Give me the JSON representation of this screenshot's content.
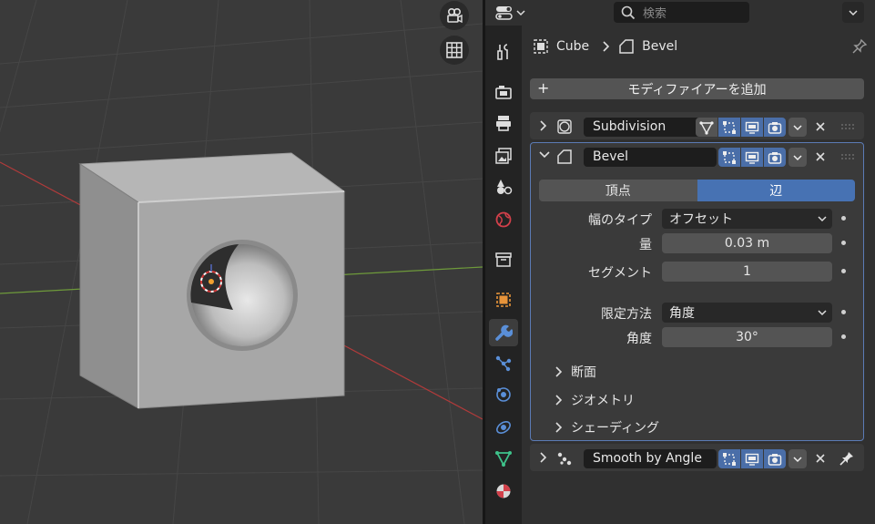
{
  "header": {
    "search_placeholder": "検索"
  },
  "breadcrumb": {
    "object": "Cube",
    "modifier": "Bevel"
  },
  "add_modifier_label": "モディファイアーを追加",
  "modifiers": [
    {
      "name": "Subdivision",
      "expanded": false
    },
    {
      "name": "Bevel",
      "expanded": true
    },
    {
      "name": "Smooth by Angle",
      "expanded": false
    }
  ],
  "bevel": {
    "affect_options": [
      "頂点",
      "辺"
    ],
    "affect_selected": "辺",
    "width_type_label": "幅のタイプ",
    "width_type_value": "オフセット",
    "amount_label": "量",
    "amount_value": "0.03 m",
    "segments_label": "セグメント",
    "segments_value": "1",
    "limit_method_label": "限定方法",
    "limit_method_value": "角度",
    "angle_label": "角度",
    "angle_value": "30°",
    "subpanels": [
      "断面",
      "ジオメトリ",
      "シェーディング"
    ]
  },
  "colors": {
    "accent": "#4772b3",
    "panel": "#303030",
    "viewport": "#3a3a3a"
  },
  "tabs": [
    "tool-icon",
    "render-icon",
    "output-icon",
    "view-layer-icon",
    "scene-icon",
    "world-icon",
    "collection-icon",
    "object-icon",
    "modifier-icon",
    "particles-icon",
    "physics-icon",
    "constraints-icon",
    "data-icon",
    "material-icon"
  ],
  "tab_active": "modifier-icon"
}
